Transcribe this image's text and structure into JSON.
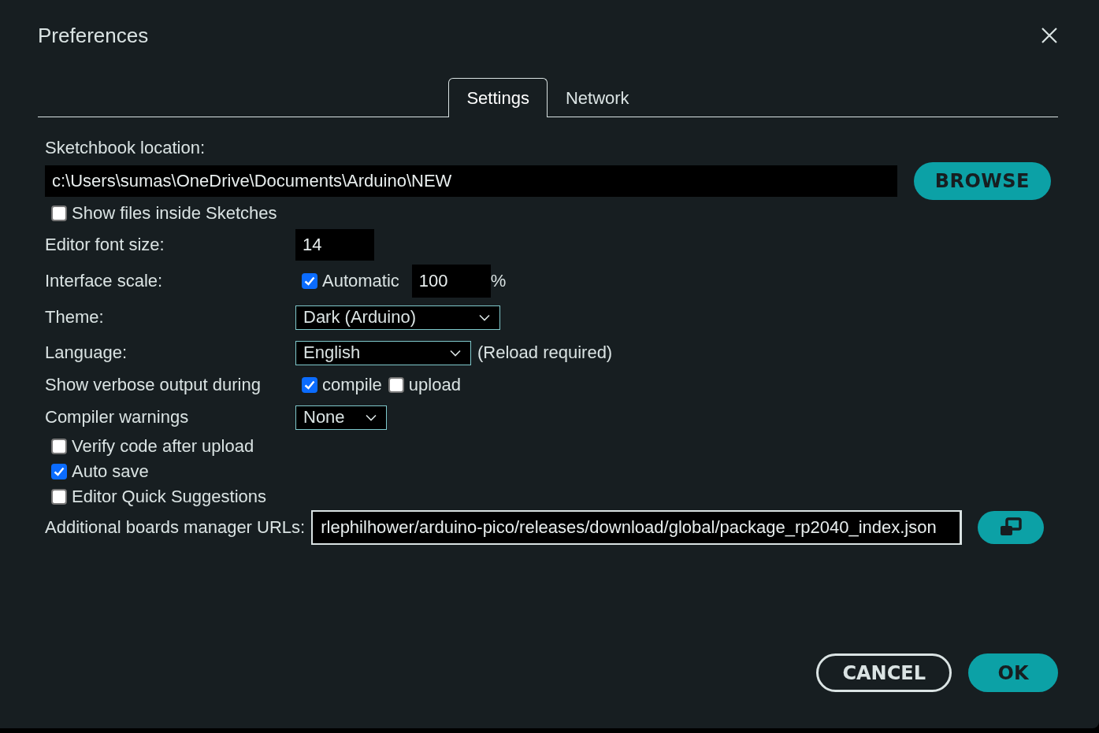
{
  "window": {
    "title": "Preferences"
  },
  "tabs": [
    {
      "label": "Settings",
      "selected": true
    },
    {
      "label": "Network",
      "selected": false
    }
  ],
  "sketchbook": {
    "label": "Sketchbook location:",
    "value": "c:\\Users\\sumas\\OneDrive\\Documents\\Arduino\\NEW",
    "button": "BROWSE"
  },
  "rows": [
    {
      "kind": "check",
      "label": "Show files inside Sketches",
      "checked": false
    },
    {
      "kind": "number",
      "label": "Editor font size:",
      "value": "14"
    },
    {
      "kind": "scale",
      "label": "Interface scale:",
      "option": "Automatic",
      "checked": true,
      "value": "100",
      "unit": "%"
    },
    {
      "kind": "select",
      "label": "Theme:",
      "value": "Dark (Arduino)"
    },
    {
      "kind": "select",
      "label": "Language:",
      "value": "English",
      "note": "(Reload required)"
    },
    {
      "kind": "checks",
      "label": "Show verbose output during",
      "options": [
        {
          "label": "compile",
          "checked": true
        },
        {
          "label": "upload",
          "checked": false
        }
      ]
    },
    {
      "kind": "select",
      "label": "Compiler warnings",
      "value": "None"
    },
    {
      "kind": "check",
      "label": "Verify code after upload",
      "checked": false
    },
    {
      "kind": "check",
      "label": "Auto save",
      "checked": true
    },
    {
      "kind": "check",
      "label": "Editor Quick Suggestions",
      "checked": false
    },
    {
      "kind": "urls",
      "label": "Additional boards manager URLs:",
      "value": "rlephilhower/arduino-pico/releases/download/global/package_rp2040_index.json"
    }
  ],
  "buttons": [
    {
      "label": "CANCEL",
      "kind": "secondary"
    },
    {
      "label": "OK",
      "kind": "primary"
    }
  ]
}
